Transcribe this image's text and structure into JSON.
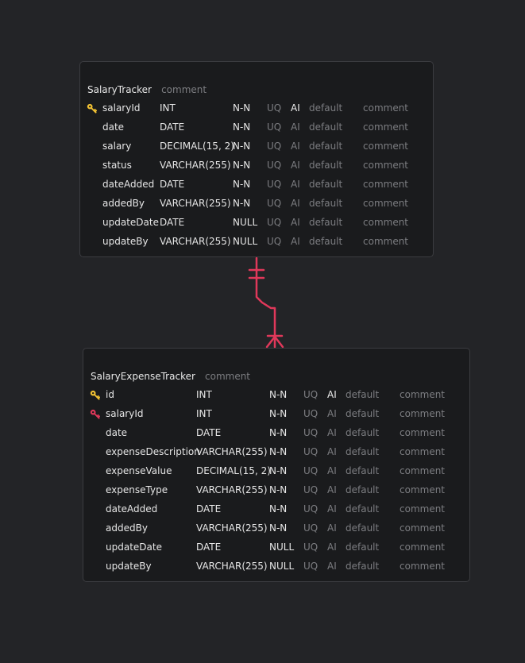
{
  "colors": {
    "background": "#232427",
    "table_bg": "#1a1b1d",
    "relation": "#e0385a",
    "primary_key": "#f2c233",
    "foreign_key": "#e0385a"
  },
  "tables": [
    {
      "name": "SalaryTracker",
      "comment": "comment",
      "columns": [
        {
          "key": "primary",
          "name": "salaryId",
          "type": "INT",
          "nullable": "N-N",
          "unique": "UQ",
          "auto_increment": "AI",
          "ai_enabled": true,
          "default": "default",
          "comment": "comment"
        },
        {
          "key": "",
          "name": "date",
          "type": "DATE",
          "nullable": "N-N",
          "unique": "UQ",
          "auto_increment": "AI",
          "ai_enabled": false,
          "default": "default",
          "comment": "comment"
        },
        {
          "key": "",
          "name": "salary",
          "type": "DECIMAL(15, 2)",
          "nullable": "N-N",
          "unique": "UQ",
          "auto_increment": "AI",
          "ai_enabled": false,
          "default": "default",
          "comment": "comment"
        },
        {
          "key": "",
          "name": "status",
          "type": "VARCHAR(255)",
          "nullable": "N-N",
          "unique": "UQ",
          "auto_increment": "AI",
          "ai_enabled": false,
          "default": "default",
          "comment": "comment"
        },
        {
          "key": "",
          "name": "dateAdded",
          "type": "DATE",
          "nullable": "N-N",
          "unique": "UQ",
          "auto_increment": "AI",
          "ai_enabled": false,
          "default": "default",
          "comment": "comment"
        },
        {
          "key": "",
          "name": "addedBy",
          "type": "VARCHAR(255)",
          "nullable": "N-N",
          "unique": "UQ",
          "auto_increment": "AI",
          "ai_enabled": false,
          "default": "default",
          "comment": "comment"
        },
        {
          "key": "",
          "name": "updateDate",
          "type": "DATE",
          "nullable": "NULL",
          "unique": "UQ",
          "auto_increment": "AI",
          "ai_enabled": false,
          "default": "default",
          "comment": "comment"
        },
        {
          "key": "",
          "name": "updateBy",
          "type": "VARCHAR(255)",
          "nullable": "NULL",
          "unique": "UQ",
          "auto_increment": "AI",
          "ai_enabled": false,
          "default": "default",
          "comment": "comment"
        }
      ]
    },
    {
      "name": "SalaryExpenseTracker",
      "comment": "comment",
      "columns": [
        {
          "key": "primary",
          "name": "id",
          "type": "INT",
          "nullable": "N-N",
          "unique": "UQ",
          "auto_increment": "AI",
          "ai_enabled": true,
          "default": "default",
          "comment": "comment"
        },
        {
          "key": "foreign",
          "name": "salaryId",
          "type": "INT",
          "nullable": "N-N",
          "unique": "UQ",
          "auto_increment": "AI",
          "ai_enabled": false,
          "default": "default",
          "comment": "comment"
        },
        {
          "key": "",
          "name": "date",
          "type": "DATE",
          "nullable": "N-N",
          "unique": "UQ",
          "auto_increment": "AI",
          "ai_enabled": false,
          "default": "default",
          "comment": "comment"
        },
        {
          "key": "",
          "name": "expenseDescription",
          "type": "VARCHAR(255)",
          "nullable": "N-N",
          "unique": "UQ",
          "auto_increment": "AI",
          "ai_enabled": false,
          "default": "default",
          "comment": "comment"
        },
        {
          "key": "",
          "name": "expenseValue",
          "type": "DECIMAL(15, 2)",
          "nullable": "N-N",
          "unique": "UQ",
          "auto_increment": "AI",
          "ai_enabled": false,
          "default": "default",
          "comment": "comment"
        },
        {
          "key": "",
          "name": "expenseType",
          "type": "VARCHAR(255)",
          "nullable": "N-N",
          "unique": "UQ",
          "auto_increment": "AI",
          "ai_enabled": false,
          "default": "default",
          "comment": "comment"
        },
        {
          "key": "",
          "name": "dateAdded",
          "type": "DATE",
          "nullable": "N-N",
          "unique": "UQ",
          "auto_increment": "AI",
          "ai_enabled": false,
          "default": "default",
          "comment": "comment"
        },
        {
          "key": "",
          "name": "addedBy",
          "type": "VARCHAR(255)",
          "nullable": "N-N",
          "unique": "UQ",
          "auto_increment": "AI",
          "ai_enabled": false,
          "default": "default",
          "comment": "comment"
        },
        {
          "key": "",
          "name": "updateDate",
          "type": "DATE",
          "nullable": "NULL",
          "unique": "UQ",
          "auto_increment": "AI",
          "ai_enabled": false,
          "default": "default",
          "comment": "comment"
        },
        {
          "key": "",
          "name": "updateBy",
          "type": "VARCHAR(255)",
          "nullable": "NULL",
          "unique": "UQ",
          "auto_increment": "AI",
          "ai_enabled": false,
          "default": "default",
          "comment": "comment"
        }
      ]
    }
  ],
  "relationship": {
    "from_table": "SalaryTracker",
    "to_table": "SalaryExpenseTracker",
    "from_cardinality": "one-and-only-one",
    "to_cardinality": "one-or-many"
  }
}
